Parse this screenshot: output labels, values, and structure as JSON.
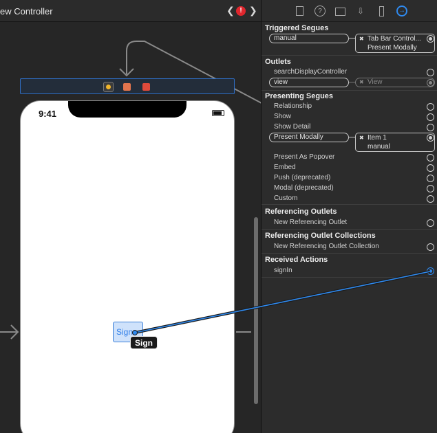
{
  "editor": {
    "title": "ew Controller",
    "back_glyph": "❮",
    "forward_glyph": "❯",
    "warning_glyph": "!"
  },
  "device": {
    "status_time": "9:41"
  },
  "canvas": {
    "sign_button_label": "Sign",
    "tooltip_text": "Sign"
  },
  "inspector": {
    "tabs": [
      "file-inspector",
      "quick-help",
      "identity-inspector",
      "attributes-inspector",
      "size-inspector",
      "connections-inspector"
    ],
    "help_glyph": "?",
    "attributes_glyph": "⇩",
    "connections_glyph": "→",
    "triggered_segues": {
      "header": "Triggered Segues",
      "row_label": "manual",
      "target_line1": "Tab Bar Control...",
      "target_line2": "Present Modally",
      "x_glyph": "✖"
    },
    "outlets": {
      "header": "Outlets",
      "search_label": "searchDisplayController",
      "view_label": "view",
      "view_target": "View",
      "x_glyph": "✖"
    },
    "presenting_segues": {
      "header": "Presenting Segues",
      "items": [
        "Relationship",
        "Show",
        "Show Detail"
      ],
      "present_modally_label": "Present Modally",
      "pm_target_line1": "Item 1",
      "pm_target_line2": "manual",
      "x_glyph": "✖",
      "more_items": [
        "Present As Popover",
        "Embed",
        "Push (deprecated)",
        "Modal (deprecated)",
        "Custom"
      ]
    },
    "referencing_outlets": {
      "header": "Referencing Outlets",
      "item": "New Referencing Outlet"
    },
    "referencing_outlet_collections": {
      "header": "Referencing Outlet Collections",
      "item": "New Referencing Outlet Collection"
    },
    "received_actions": {
      "header": "Received Actions",
      "item": "signIn"
    }
  },
  "colors": {
    "accent": "#2f8af0",
    "canvas_bg": "#262626",
    "inspector_bg": "#2c2c2c",
    "warning": "#e0262d"
  }
}
